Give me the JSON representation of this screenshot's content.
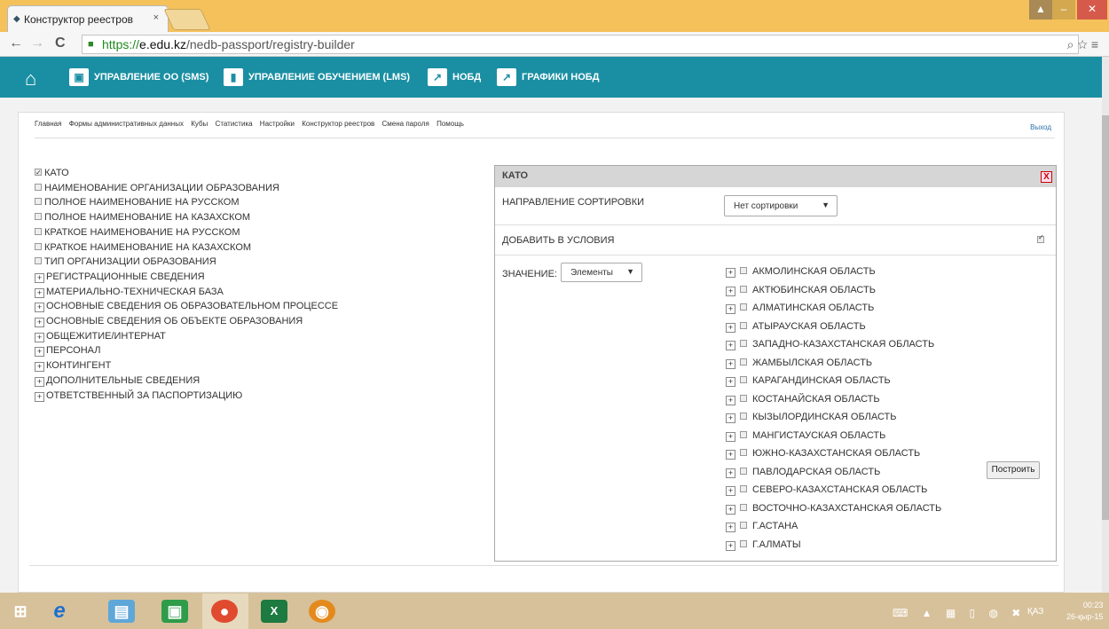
{
  "browser": {
    "tab_title": "Конструктор реестров",
    "tab_close": "×",
    "url_scheme": "https://",
    "url_host": "e.edu.kz",
    "url_path": "/nedb-passport/registry-builder"
  },
  "appnav": {
    "items": [
      {
        "label": "УПРАВЛЕНИЕ ОО (SMS)"
      },
      {
        "label": "УПРАВЛЕНИЕ ОБУЧЕНИЕМ (LMS)"
      },
      {
        "label": "НОБД"
      },
      {
        "label": "ГРАФИКИ НОБД"
      }
    ],
    "color": "#1a8fa3"
  },
  "breadcrumb": {
    "items": [
      "Главная",
      "Формы административных данных",
      "Кубы",
      "Статистика",
      "Настройки",
      "Конструктор реестров",
      "Смена пароля",
      "Помощь"
    ],
    "logout": "Выход"
  },
  "tree": {
    "checkbox_items": [
      {
        "label": "КАТО",
        "checked": true
      },
      {
        "label": "НАИМЕНОВАНИЕ ОРГАНИЗАЦИИ ОБРАЗОВАНИЯ",
        "checked": false
      },
      {
        "label": "ПОЛНОЕ НАИМЕНОВАНИЕ НА РУССКОМ",
        "checked": false
      },
      {
        "label": "ПОЛНОЕ НАИМЕНОВАНИЕ НА КАЗАХСКОМ",
        "checked": false
      },
      {
        "label": "КРАТКОЕ НАИМЕНОВАНИЕ НА РУССКОМ",
        "checked": false
      },
      {
        "label": "КРАТКОЕ НАИМЕНОВАНИЕ НА КАЗАХСКОМ",
        "checked": false
      },
      {
        "label": "ТИП ОРГАНИЗАЦИИ ОБРАЗОВАНИЯ",
        "checked": false
      }
    ],
    "expandable_items": [
      "РЕГИСТРАЦИОННЫЕ СВЕДЕНИЯ",
      "МАТЕРИАЛЬНО-ТЕХНИЧЕСКАЯ БАЗА",
      "ОСНОВНЫЕ СВЕДЕНИЯ ОБ ОБРАЗОВАТЕЛЬНОМ ПРОЦЕССЕ",
      "ОСНОВНЫЕ СВЕДЕНИЯ ОБ ОБЪЕКТЕ ОБРАЗОВАНИЯ",
      "ОБЩЕЖИТИЕ/ИНТЕРНАТ",
      "ПЕРСОНАЛ",
      "КОНТИНГЕНТ",
      "ДОПОЛНИТЕЛЬНЫЕ СВЕДЕНИЯ",
      "ОТВЕТСТВЕННЫЙ ЗА ПАСПОРТИЗАЦИЮ"
    ]
  },
  "panel": {
    "title": "КАТО",
    "close": "X",
    "sort_label": "НАПРАВЛЕНИЕ СОРТИРОВКИ",
    "sort_value": "Нет сортировки",
    "add_conditions_label": "ДОБАВИТЬ В УСЛОВИЯ",
    "add_conditions_checked": true,
    "value_label": "ЗНАЧЕНИЕ:",
    "value_select": "Элементы",
    "regions": [
      "АКМОЛИНСКАЯ ОБЛАСТЬ",
      "АКТЮБИНСКАЯ ОБЛАСТЬ",
      "АЛМАТИНСКАЯ ОБЛАСТЬ",
      "АТЫРАУСКАЯ ОБЛАСТЬ",
      "ЗАПАДНО-КАЗАХСТАНСКАЯ ОБЛАСТЬ",
      "ЖАМБЫЛСКАЯ ОБЛАСТЬ",
      "КАРАГАНДИНСКАЯ ОБЛАСТЬ",
      "КОСТАНАЙСКАЯ ОБЛАСТЬ",
      "КЫЗЫЛОРДИНСКАЯ ОБЛАСТЬ",
      "МАНГИСТАУСКАЯ ОБЛАСТЬ",
      "ЮЖНО-КАЗАХСТАНСКАЯ ОБЛАСТЬ",
      "ПАВЛОДАРСКАЯ ОБЛАСТЬ",
      "СЕВЕРО-КАЗАХСТАНСКАЯ ОБЛАСТЬ",
      "ВОСТОЧНО-КАЗАХСТАНСКАЯ ОБЛАСТЬ",
      "Г.АСТАНА",
      "Г.АЛМАТЫ"
    ]
  },
  "build_button": "Построить",
  "taskbar": {
    "language": "ҚАЗ",
    "time": "00:23",
    "date": "26-қыр-15"
  }
}
